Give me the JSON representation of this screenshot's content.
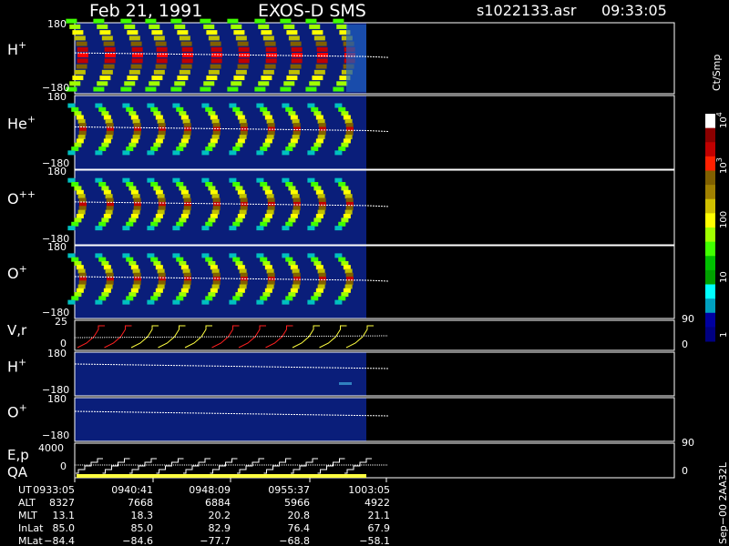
{
  "header": {
    "date": "Feb 21, 1991",
    "instrument": "EXOS-D SMS",
    "file": "s1022133.asr",
    "time": "09:33:05"
  },
  "chart_data": {
    "type": "heatmap",
    "panels": [
      {
        "label": "H",
        "sup": "+",
        "ymax": "180",
        "ymin": "−180"
      },
      {
        "label": "He",
        "sup": "+",
        "ymax": "180",
        "ymin": "−180"
      },
      {
        "label": "O",
        "sup": "++",
        "ymax": "180",
        "ymin": "−180"
      },
      {
        "label": "O",
        "sup": "+",
        "ymax": "180",
        "ymin": "−180"
      }
    ],
    "vr_panel": {
      "label": "V,r",
      "ymax": "25",
      "ymin": "0",
      "right_top": "90",
      "right_bottom": "0"
    },
    "h_panel": {
      "label": "H",
      "sup": "+",
      "ymax": "180",
      "ymin": "−180"
    },
    "o_panel": {
      "label": "O",
      "sup": "+",
      "ymax": "180",
      "ymin": "−180"
    },
    "ep_panel": {
      "label1": "E,p",
      "label2": "QA",
      "ymax": "4000",
      "ymin": "0",
      "right_top": "90",
      "right_bottom": "0"
    },
    "colorbar": {
      "unit": "Ct/Smp",
      "ticks": [
        "10",
        "10",
        "100",
        "10",
        "1"
      ],
      "exps": [
        "4",
        "3"
      ],
      "colors": [
        "#ffffff",
        "#8b0000",
        "#c00000",
        "#ff2000",
        "#806000",
        "#a08000",
        "#d0c000",
        "#ffff00",
        "#a0ff00",
        "#40ff00",
        "#00c000",
        "#00a000",
        "#00ffff",
        "#00a0c0",
        "#0000a0",
        "#000080"
      ]
    },
    "time_axis": {
      "ticks": [
        {
          "ut": "0933:05",
          "alt": "8327",
          "mlt": "13.1",
          "inlat": "85.0",
          "mlat": "−84.4"
        },
        {
          "ut": "0940:41",
          "alt": "7668",
          "mlt": "18.3",
          "inlat": "85.0",
          "mlat": "−84.6"
        },
        {
          "ut": "0948:09",
          "alt": "6884",
          "mlt": "20.2",
          "inlat": "82.9",
          "mlat": "−77.7"
        },
        {
          "ut": "0955:37",
          "alt": "5966",
          "mlt": "20.8",
          "inlat": "76.4",
          "mlat": "−68.8"
        },
        {
          "ut": "1003:05",
          "alt": "4922",
          "mlt": "21.1",
          "inlat": "67.9",
          "mlat": "−58.1"
        }
      ],
      "row_labels": [
        "UT",
        "ALT",
        "MLT",
        "InLat",
        "MLat"
      ]
    },
    "footer_code": "Sep−00 2AA32L"
  },
  "colors": {
    "background": "#000000",
    "panel_fill": "#0a1e7a",
    "trace": "#ffffff"
  }
}
